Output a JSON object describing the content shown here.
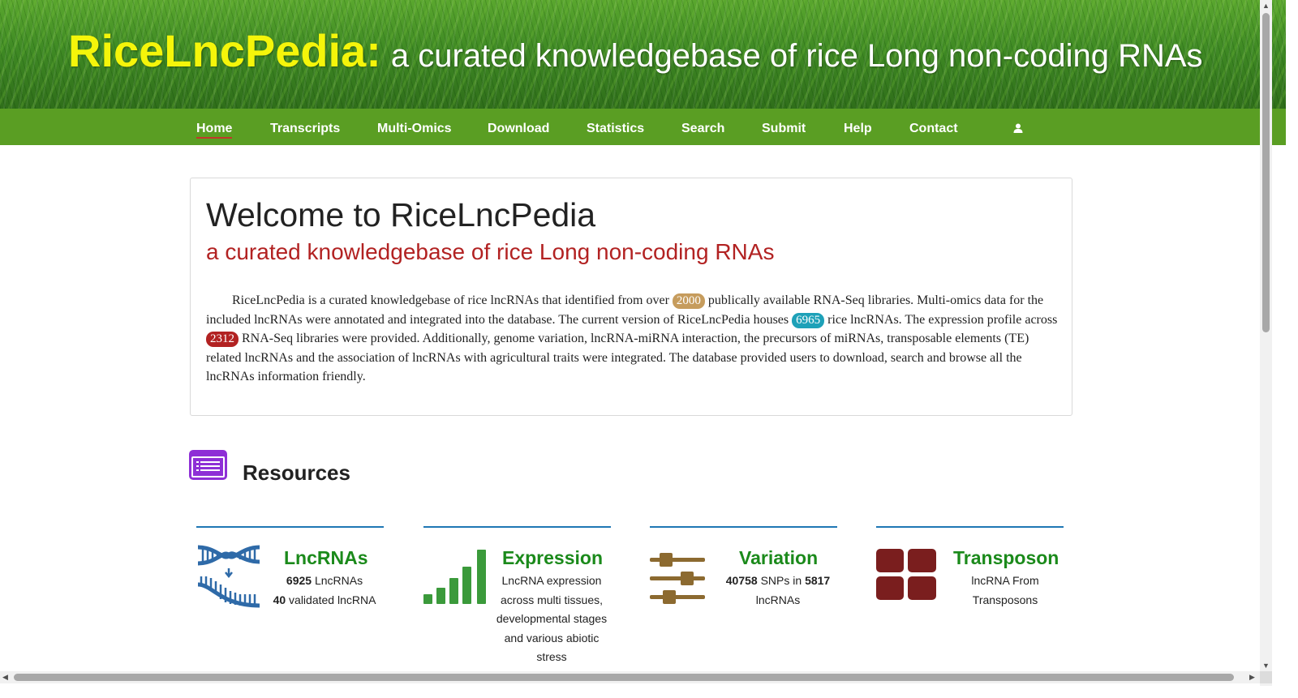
{
  "header": {
    "site_name": "RiceLncPedia:",
    "tagline": "a curated knowledgebase of rice Long non-coding RNAs"
  },
  "nav": {
    "items": [
      "Home",
      "Transcripts",
      "Multi-Omics",
      "Download",
      "Statistics",
      "Search",
      "Submit",
      "Help",
      "Contact"
    ],
    "active": "Home",
    "user_icon": "user-icon"
  },
  "welcome": {
    "title": "Welcome to RiceLncPedia",
    "subtitle": "a curated knowledgebase of rice Long non-coding RNAs",
    "text1": "RiceLncPedia is a curated knowledgebase of rice lncRNAs that identified from over",
    "badge1": "2000",
    "text2": "publically available RNA-Seq libraries. Multi-omics data for the included lncRNAs were annotated and integrated into the database. The current version of RiceLncPedia houses",
    "badge2": "6965",
    "text3": "rice lncRNAs. The expression profile across",
    "badge3": "2312",
    "text4": "RNA-Seq libraries were provided. Additionally, genome variation, lncRNA-miRNA interaction, the precursors of miRNAs, transposable elements (TE) related lncRNAs and the association of lncRNAs with agricultural traits were integrated. The database provided users to download, search and browse all the lncRNAs information friendly."
  },
  "resources": {
    "title": "Resources",
    "icon": "list-icon",
    "cards": [
      {
        "title": "LncRNAs",
        "icon": "dna-icon",
        "line1_num": "6925",
        "line1_text": " LncRNAs",
        "line2_num": "40",
        "line2_text": " validated lncRNA"
      },
      {
        "title": "Expression",
        "icon": "signal-bars-icon",
        "desc": "LncRNA expression across multi tissues, developmental stages and various abiotic stress"
      },
      {
        "title": "Variation",
        "icon": "sliders-icon",
        "num1": "40758",
        "text_mid": " SNPs in ",
        "num2": "5817",
        "text_end": "lncRNAs"
      },
      {
        "title": "Transposon",
        "icon": "grid-icon",
        "desc": "lncRNA From Transposons"
      }
    ]
  },
  "colors": {
    "nav_bg": "#5a9e23",
    "site_name": "#f5f50a",
    "subtitle": "#b22222",
    "card_title": "#1b8a1b",
    "badge_tan": "#c69c5d",
    "badge_teal": "#1ea1b8",
    "badge_red": "#b22222"
  }
}
